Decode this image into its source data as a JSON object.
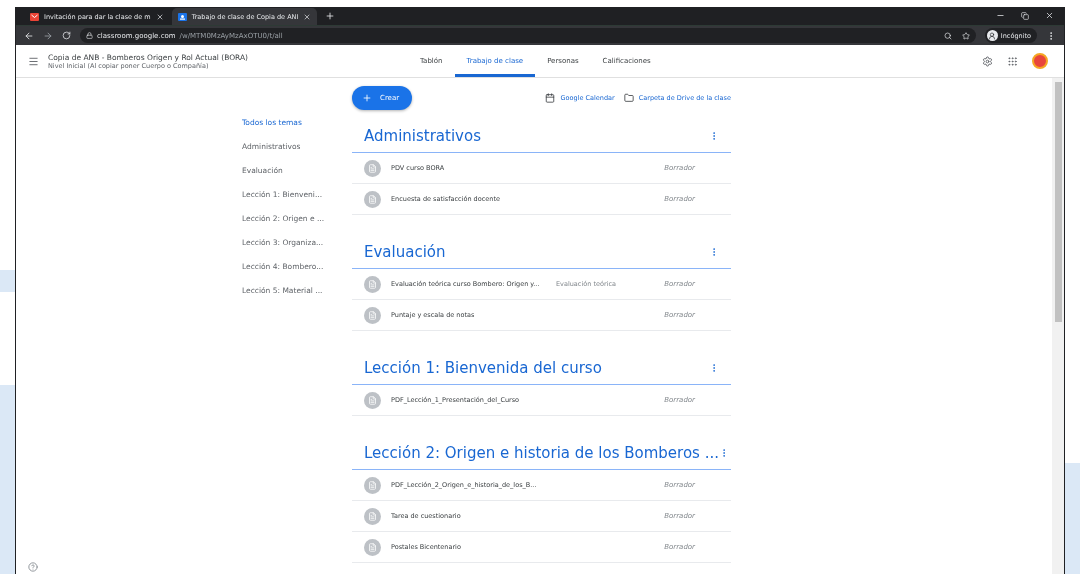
{
  "browser": {
    "tabs": [
      {
        "title": "Invitación para dar la clase de m",
        "selected": false,
        "kind": "mail"
      },
      {
        "title": "Trabajo de clase de Copia de ANI",
        "selected": true,
        "kind": "classroom"
      }
    ],
    "url_host": "classroom.google.com",
    "url_path": "/w/MTM0MzAyMzAxOTU0/t/all",
    "profile": "Incógnito"
  },
  "header": {
    "title": "Copia de ANB - Bomberos Origen y Rol Actual (BORA)",
    "subtitle": "Nivel Inicial (Al copiar poner Cuerpo o Compañía)",
    "nav": [
      {
        "label": "Tablón",
        "selected": false
      },
      {
        "label": "Trabajo de clase",
        "selected": true
      },
      {
        "label": "Personas",
        "selected": false
      },
      {
        "label": "Calificaciones",
        "selected": false
      }
    ]
  },
  "toolbar": {
    "create": "Crear",
    "links": [
      {
        "label": "Google Calendar",
        "kind": "calendar"
      },
      {
        "label": "Carpeta de Drive de la clase",
        "kind": "folder"
      }
    ]
  },
  "topics": [
    {
      "label": "Todos los temas",
      "selected": true
    },
    {
      "label": "Administrativos",
      "selected": false
    },
    {
      "label": "Evaluación",
      "selected": false
    },
    {
      "label": "Lección 1: Bienveni...",
      "selected": false
    },
    {
      "label": "Lección 2: Origen e ...",
      "selected": false
    },
    {
      "label": "Lección 3: Organiza...",
      "selected": false
    },
    {
      "label": "Lección 4: Bombero...",
      "selected": false
    },
    {
      "label": "Lección 5: Material ...",
      "selected": false
    }
  ],
  "sections": [
    {
      "title": "Administrativos",
      "items": [
        {
          "title": "PDV curso BORA",
          "status": "Borrador"
        },
        {
          "title": "Encuesta de satisfacción docente",
          "status": "Borrador"
        }
      ]
    },
    {
      "title": "Evaluación",
      "items": [
        {
          "title": "Evaluación teórica curso Bombero: Origen y...",
          "tag": "Evaluación teórica",
          "status": "Borrador"
        },
        {
          "title": "Puntaje y escala de notas",
          "status": "Borrador"
        }
      ]
    },
    {
      "title": "Lección 1: Bienvenida del curso",
      "items": [
        {
          "title": "PDF_Lección_1_Presentación_del_Curso",
          "status": "Borrador"
        }
      ]
    },
    {
      "title": "Lección 2: Origen e historia de los Bomberos ...",
      "items": [
        {
          "title": "PDF_Lección_2_Origen_e_historia_de_los_B...",
          "status": "Borrador"
        },
        {
          "title": "Tarea de cuestionario",
          "status": "Borrador"
        },
        {
          "title": "Postales Bicentenario",
          "status": "Borrador"
        }
      ]
    }
  ]
}
